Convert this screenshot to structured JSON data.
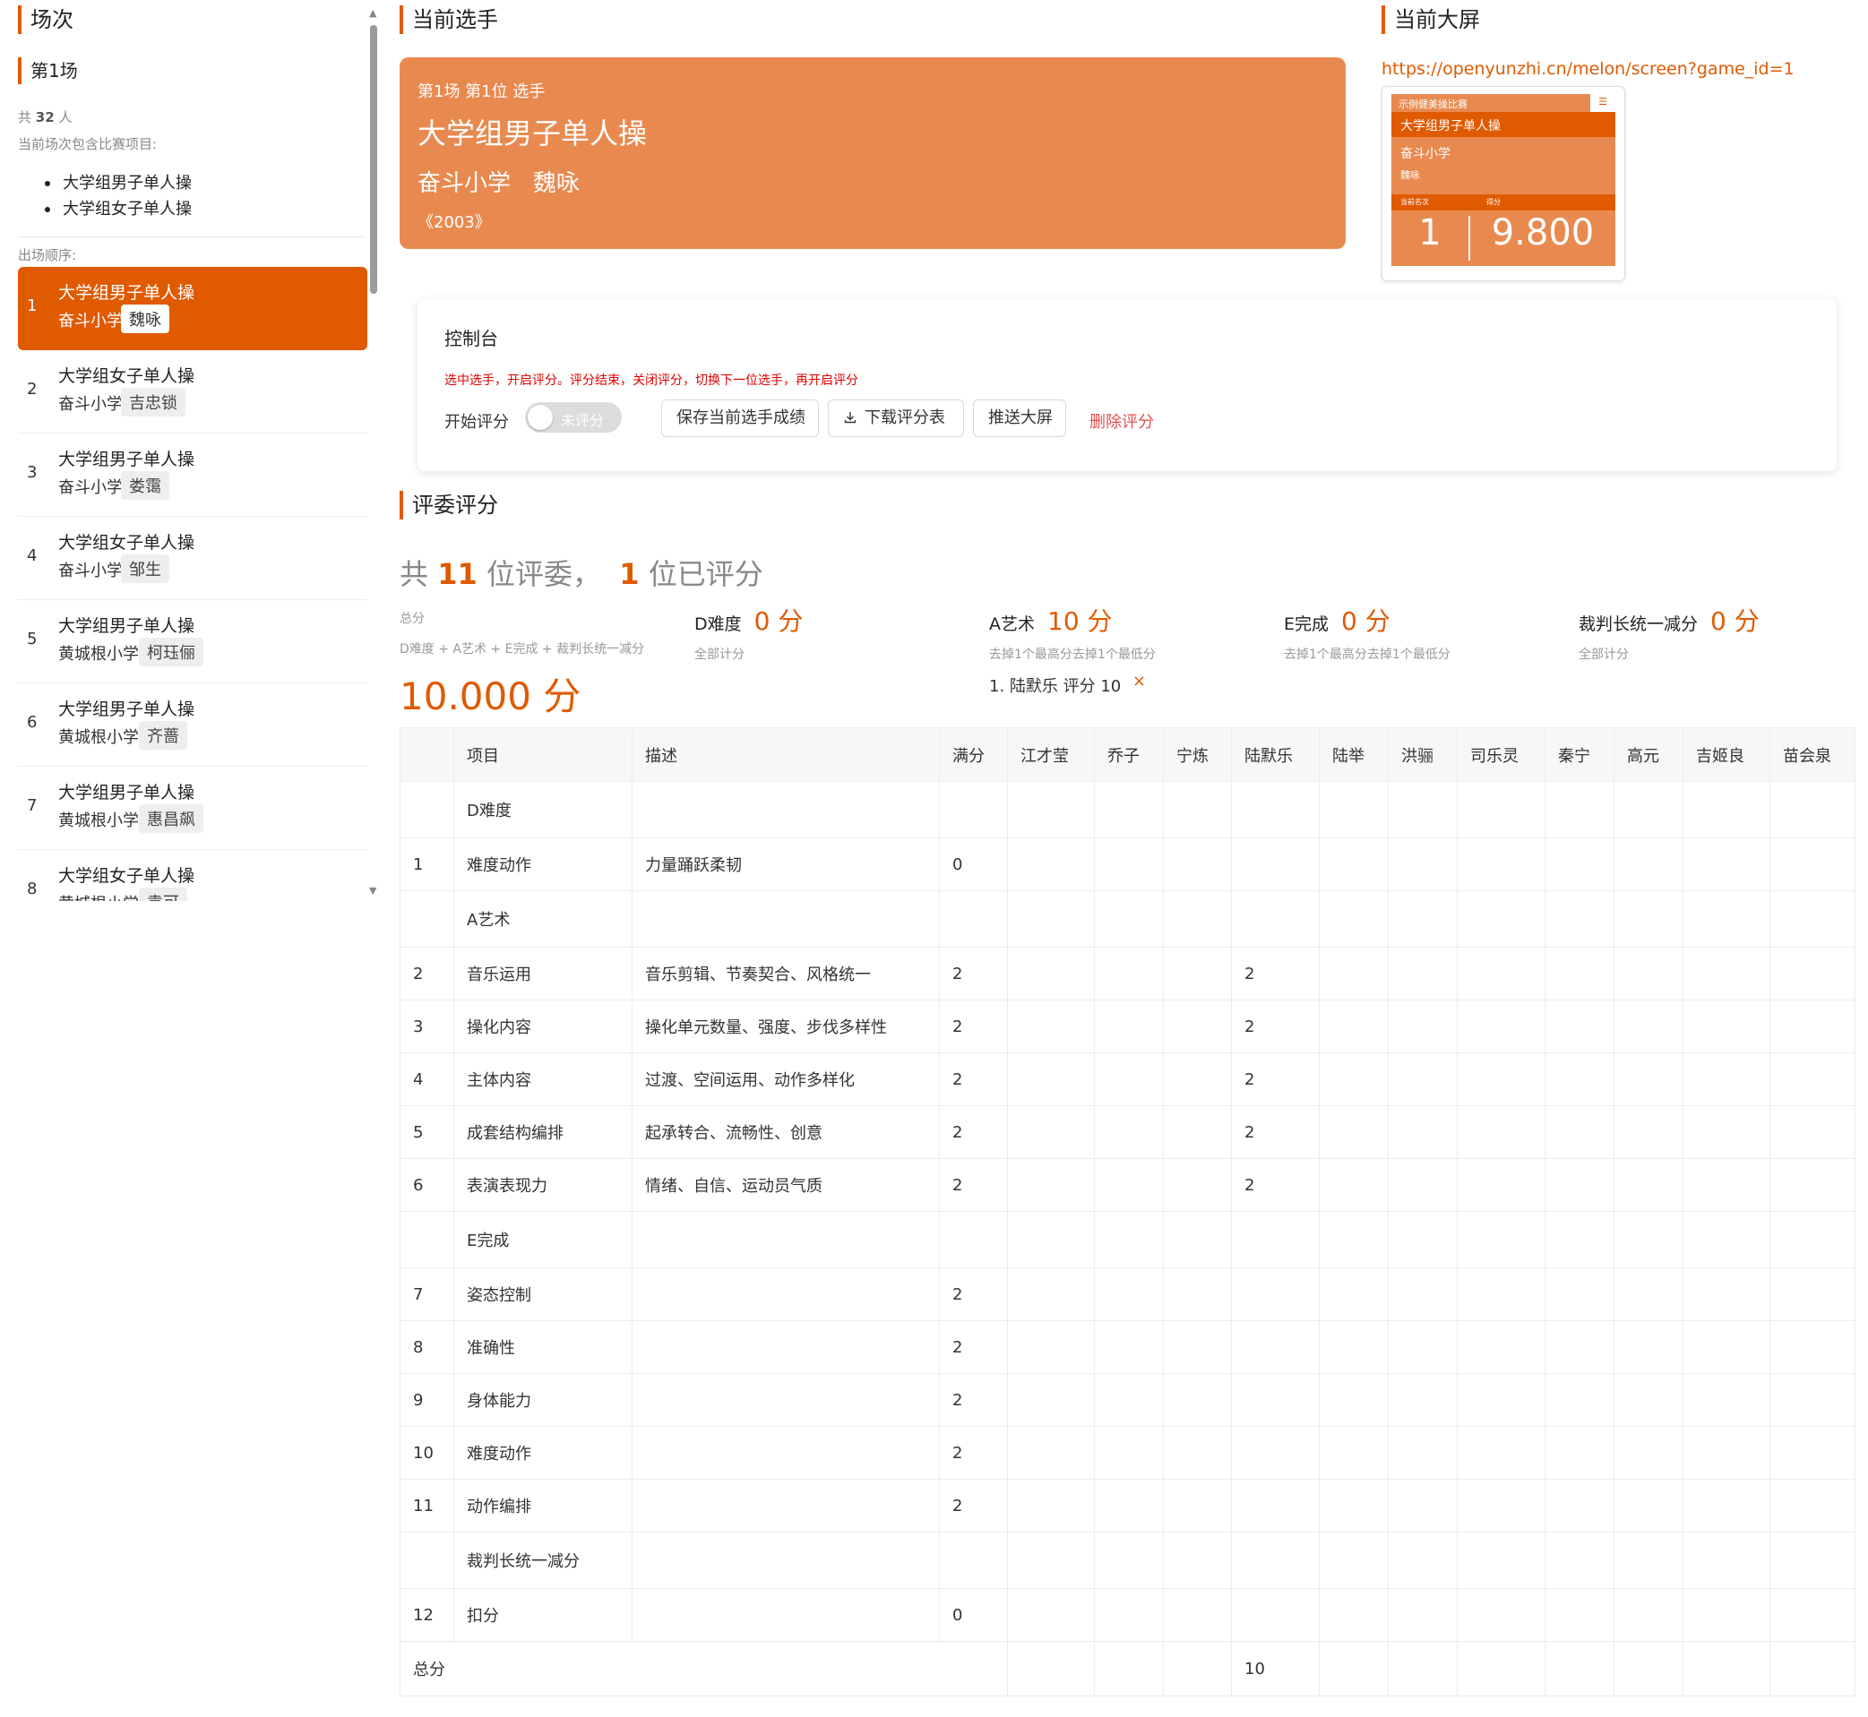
{
  "sidebar": {
    "title": "场次",
    "round": "第1场",
    "total_prefix": "共",
    "total_count": "32",
    "total_suffix": "人",
    "events_label": "当前场次包含比赛项目:",
    "events": [
      "大学组男子单人操",
      "大学组女子单人操"
    ],
    "order_label": "出场顺序:",
    "roster": [
      {
        "num": "1",
        "event": "大学组男子单人操",
        "school": "奋斗小学",
        "athlete": "魏咏",
        "active": true
      },
      {
        "num": "2",
        "event": "大学组女子单人操",
        "school": "奋斗小学",
        "athlete": "吉忠锁"
      },
      {
        "num": "3",
        "event": "大学组男子单人操",
        "school": "奋斗小学",
        "athlete": "娄霭"
      },
      {
        "num": "4",
        "event": "大学组女子单人操",
        "school": "奋斗小学",
        "athlete": "邹生"
      },
      {
        "num": "5",
        "event": "大学组男子单人操",
        "school": "黄城根小学",
        "athlete": "柯珏俪"
      },
      {
        "num": "6",
        "event": "大学组男子单人操",
        "school": "黄城根小学",
        "athlete": "齐蔷"
      },
      {
        "num": "7",
        "event": "大学组男子单人操",
        "school": "黄城根小学",
        "athlete": "惠昌飙"
      },
      {
        "num": "8",
        "event": "大学组女子单人操",
        "school": "黄城根小学",
        "athlete": "袁可"
      }
    ]
  },
  "current_athlete": {
    "title": "当前选手",
    "label": "第1场 第1位 选手",
    "event": "大学组男子单人操",
    "school": "奋斗小学",
    "name": "魏咏",
    "music": "《2003》"
  },
  "current_screen": {
    "title": "当前大屏",
    "url": "https://openyunzhi.cn/melon/screen?game_id=1",
    "thumb": {
      "competition": "示例健美操比赛",
      "menu_icon": "menu-icon",
      "event": "大学组男子单人操",
      "school": "奋斗小学",
      "name": "魏咏",
      "rank_label": "当前名次",
      "score_label": "得分",
      "rank": "1",
      "score": "9.800"
    }
  },
  "console": {
    "title": "控制台",
    "hint": "选中选手，开启评分。评分结束，关闭评分，切换下一位选手，再开启评分",
    "start_label": "开始评分",
    "toggle_text": "未评分",
    "save_label": "保存当前选手成绩",
    "download_label": "下载评分表",
    "push_label": "推送大屏",
    "delete_label": "删除评分"
  },
  "judges": {
    "title": "评委评分",
    "prefix": "共 ",
    "count": "11",
    "mid": " 位评委，  ",
    "scored": "1",
    "suffix": " 位已评分",
    "total_label": "总分",
    "total_formula": "D难度 + A艺术 + E完成 + 裁判长统一减分",
    "total_value": "10.000 分",
    "blocks": [
      {
        "name": "D难度",
        "value": "0 分",
        "sub": "全部计分"
      },
      {
        "name": "A艺术",
        "value": "10 分",
        "sub": "去掉1个最高分去掉1个最低分"
      },
      {
        "name": "E完成",
        "value": "0 分",
        "sub": "去掉1个最高分去掉1个最低分"
      },
      {
        "name": "裁判长统一减分",
        "value": "0 分",
        "sub": "全部计分"
      }
    ],
    "removed": "1. 陆默乐 评分 10",
    "removed_x": "×"
  },
  "table": {
    "headers": [
      "",
      "项目",
      "描述",
      "满分",
      "江才莹",
      "乔子",
      "宁炼",
      "陆默乐",
      "陆举",
      "洪骊",
      "司乐灵",
      "秦宁",
      "高元",
      "吉姬良",
      "苗会泉"
    ],
    "rows": [
      {
        "type": "group",
        "item": "D难度"
      },
      {
        "no": "1",
        "item": "难度动作",
        "desc": "力量踊跃柔韧",
        "full": "0",
        "scores": [
          "",
          "",
          "",
          "",
          "",
          "",
          "",
          "",
          "",
          "",
          ""
        ]
      },
      {
        "type": "group",
        "item": "A艺术"
      },
      {
        "no": "2",
        "item": "音乐运用",
        "desc": "音乐剪辑、节奏契合、风格统一",
        "full": "2",
        "scores": [
          "",
          "",
          "",
          "2",
          "",
          "",
          "",
          "",
          "",
          "",
          ""
        ]
      },
      {
        "no": "3",
        "item": "操化内容",
        "desc": "操化单元数量、强度、步伐多样性",
        "full": "2",
        "scores": [
          "",
          "",
          "",
          "2",
          "",
          "",
          "",
          "",
          "",
          "",
          ""
        ]
      },
      {
        "no": "4",
        "item": "主体内容",
        "desc": "过渡、空间运用、动作多样化",
        "full": "2",
        "scores": [
          "",
          "",
          "",
          "2",
          "",
          "",
          "",
          "",
          "",
          "",
          ""
        ]
      },
      {
        "no": "5",
        "item": "成套结构编排",
        "desc": "起承转合、流畅性、创意",
        "full": "2",
        "scores": [
          "",
          "",
          "",
          "2",
          "",
          "",
          "",
          "",
          "",
          "",
          ""
        ]
      },
      {
        "no": "6",
        "item": "表演表现力",
        "desc": "情绪、自信、运动员气质",
        "full": "2",
        "scores": [
          "",
          "",
          "",
          "2",
          "",
          "",
          "",
          "",
          "",
          "",
          ""
        ]
      },
      {
        "type": "group",
        "item": "E完成"
      },
      {
        "no": "7",
        "item": "姿态控制",
        "desc": "",
        "full": "2",
        "scores": [
          "",
          "",
          "",
          "",
          "",
          "",
          "",
          "",
          "",
          "",
          ""
        ]
      },
      {
        "no": "8",
        "item": "准确性",
        "desc": "",
        "full": "2",
        "scores": [
          "",
          "",
          "",
          "",
          "",
          "",
          "",
          "",
          "",
          "",
          ""
        ]
      },
      {
        "no": "9",
        "item": "身体能力",
        "desc": "",
        "full": "2",
        "scores": [
          "",
          "",
          "",
          "",
          "",
          "",
          "",
          "",
          "",
          "",
          ""
        ]
      },
      {
        "no": "10",
        "item": "难度动作",
        "desc": "",
        "full": "2",
        "scores": [
          "",
          "",
          "",
          "",
          "",
          "",
          "",
          "",
          "",
          "",
          ""
        ]
      },
      {
        "no": "11",
        "item": "动作编排",
        "desc": "",
        "full": "2",
        "scores": [
          "",
          "",
          "",
          "",
          "",
          "",
          "",
          "",
          "",
          "",
          ""
        ]
      },
      {
        "type": "group",
        "item": "裁判长统一减分"
      },
      {
        "no": "12",
        "item": "扣分",
        "desc": "",
        "full": "0",
        "scores": [
          "",
          "",
          "",
          "",
          "",
          "",
          "",
          "",
          "",
          "",
          ""
        ]
      },
      {
        "type": "total",
        "label": "总分",
        "scores": [
          "",
          "",
          "",
          "10",
          "",
          "",
          "",
          "",
          "",
          "",
          ""
        ]
      }
    ]
  },
  "colors": {
    "accent": "#e05a00",
    "card": "#e88a50",
    "danger": "#e05050",
    "hint": "#e00000"
  }
}
